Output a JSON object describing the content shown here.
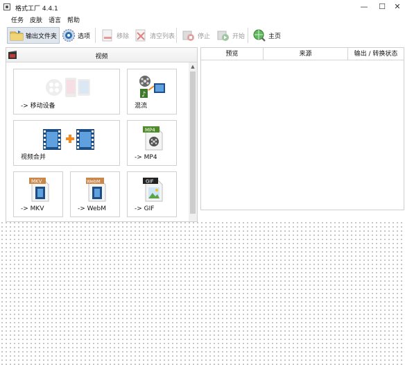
{
  "window": {
    "title": "格式工厂 4.4.1",
    "minimize": "—",
    "maximize": "☐",
    "close": "✕"
  },
  "menu": [
    "任务",
    "皮肤",
    "语言",
    "帮助"
  ],
  "toolbar": {
    "output_folder": "输出文件夹",
    "options": "选项",
    "remove": "移除",
    "clear_list": "清空列表",
    "stop": "停止",
    "start": "开始",
    "home": "主页"
  },
  "category": {
    "label": "视频"
  },
  "tiles": [
    {
      "label": "-> 移动设备"
    },
    {
      "label": "混流"
    },
    {
      "label": "视频合并"
    },
    {
      "label": "-> MP4",
      "badge": "MP4"
    },
    {
      "label": "-> MKV",
      "badge": "MKV"
    },
    {
      "label": "-> WebM",
      "badge": "WebM"
    },
    {
      "label": "-> GIF",
      "badge": "GIF"
    }
  ],
  "task_table": {
    "columns": [
      "预览",
      "来源",
      "输出 / 转换状态"
    ]
  },
  "colors": {
    "accent": "#2b6fb5",
    "film": "#1d4f86",
    "plus": "#f28a1c",
    "badge_green": "#4f8a2b"
  }
}
